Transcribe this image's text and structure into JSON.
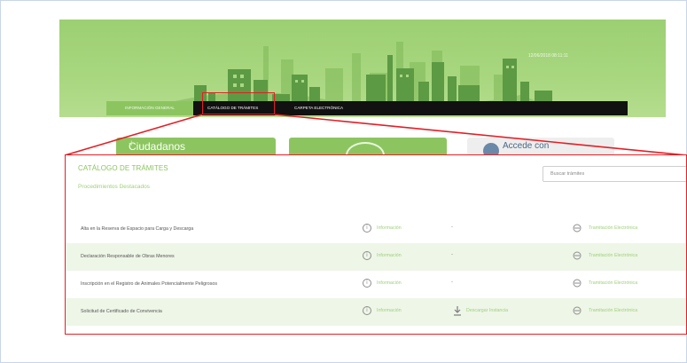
{
  "header": {
    "timestamp": "12/06/2018 08:11:11"
  },
  "nav": {
    "items": [
      {
        "label": "INFORMACIÓN GENERAL"
      },
      {
        "label": "CATÁLOGO DE TRÁMITES"
      },
      {
        "label": "CARPETA ELECTRÓNICA"
      }
    ]
  },
  "cards": {
    "ciudadanos": "Ciudadanos",
    "plus": "+",
    "accede": "Accede con"
  },
  "catalog": {
    "title": "CATÁLOGO DE TRÁMITES",
    "subtitle": "Procedimientos Destacados",
    "search_placeholder": "Buscar trámites",
    "rows": [
      {
        "name": "Alta en la Reserva de Espacio para Carga y Descarga",
        "info": "Información",
        "download": "-",
        "tramitacion": "Tramitación Electrónica"
      },
      {
        "name": "Declaración Responsable de Obras Menores",
        "info": "Información",
        "download": "-",
        "tramitacion": "Tramitación Electrónica"
      },
      {
        "name": "Inscripción en el Registro de Animales Potencialmente Peligrosos",
        "info": "Información",
        "download": "-",
        "tramitacion": "Tramitación Electrónica"
      },
      {
        "name": "Solicitud de Certificado de Convivencia",
        "info": "Información",
        "download": "Descargar Instancia",
        "tramitacion": "Tramitación Electrónica"
      }
    ]
  },
  "icons": {
    "info": "i"
  },
  "colors": {
    "accent_green": "#8cc560",
    "highlight_red": "#e51e25",
    "nav_black": "#111111"
  }
}
